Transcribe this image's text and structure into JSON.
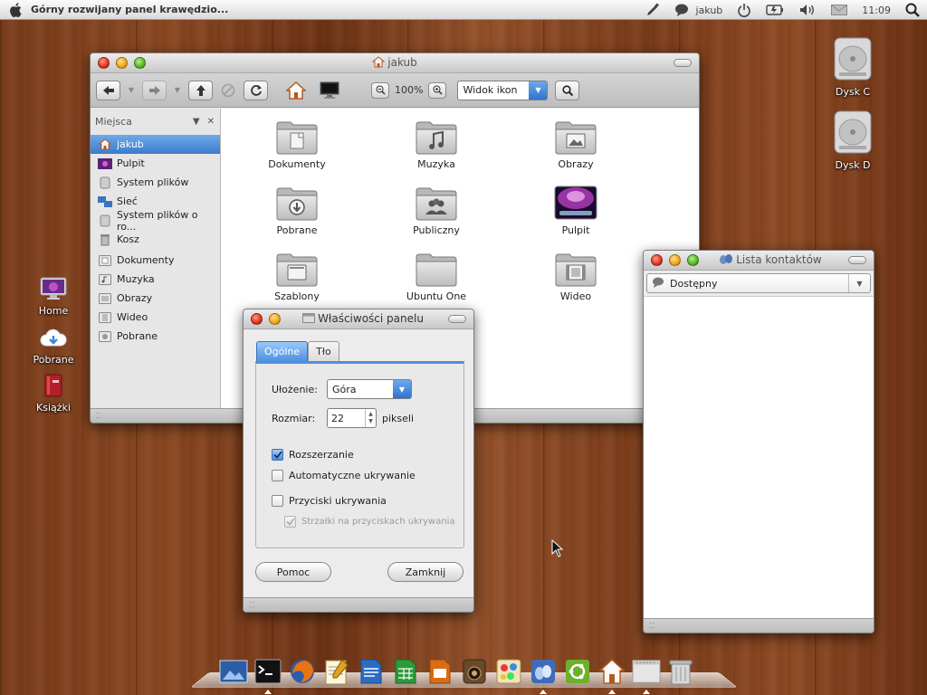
{
  "top_panel": {
    "title": "Górny rozwijany panel krawędzio...",
    "user": "jakub",
    "clock": "11:09"
  },
  "desktop_icons": {
    "home": "Home",
    "downloads": "Pobrane",
    "books": "Książki",
    "disk_c": "Dysk C",
    "disk_d": "Dysk D"
  },
  "file_manager": {
    "title": "jakub",
    "zoom": "100%",
    "view_mode": "Widok ikon",
    "sidebar_header": "Miejsca",
    "sidebar_items": [
      {
        "label": "jakub",
        "selected": true
      },
      {
        "label": "Pulpit"
      },
      {
        "label": "System plików"
      },
      {
        "label": "Sieć"
      },
      {
        "label": "System plików o ro..."
      },
      {
        "label": "Kosz"
      },
      {
        "label": "Dokumenty"
      },
      {
        "label": "Muzyka"
      },
      {
        "label": "Obrazy"
      },
      {
        "label": "Wideo"
      },
      {
        "label": "Pobrane"
      }
    ],
    "folders": [
      {
        "label": "Dokumenty"
      },
      {
        "label": "Muzyka"
      },
      {
        "label": "Obrazy"
      },
      {
        "label": "Pobrane"
      },
      {
        "label": "Publiczny"
      },
      {
        "label": "Pulpit"
      },
      {
        "label": "Szablony"
      },
      {
        "label": "Ubuntu One"
      },
      {
        "label": "Wideo"
      }
    ]
  },
  "contacts": {
    "title": "Lista kontaktów",
    "status": "Dostępny"
  },
  "panel_dialog": {
    "title": "Właściwości panelu",
    "tabs": [
      "Ogólne",
      "Tło"
    ],
    "orientation_label": "Ułożenie:",
    "orientation_value": "Góra",
    "size_label": "Rozmiar:",
    "size_value": "22",
    "size_unit": "pikseli",
    "expand_label": "Rozszerzanie",
    "expand_checked": true,
    "autohide_label": "Automatyczne ukrywanie",
    "autohide_checked": false,
    "hide_buttons_label": "Przyciski ukrywania",
    "hide_buttons_checked": false,
    "arrows_label": "Strzałki na przyciskach ukrywania",
    "arrows_checked": true,
    "help_button": "Pomoc",
    "close_button": "Zamknij"
  },
  "dock": {
    "items": [
      "preview-icon",
      "terminal-icon",
      "firefox-icon",
      "text-editor-icon",
      "writer-icon",
      "calc-icon",
      "impress-icon",
      "speaker-icon",
      "paint-icon",
      "pidgin-icon",
      "ubuntu-icon",
      "home-folder-icon",
      "window-icon",
      "trash-icon"
    ]
  },
  "colors": {
    "accent": "#3b7bcb",
    "wood": "#7a3d1b"
  }
}
